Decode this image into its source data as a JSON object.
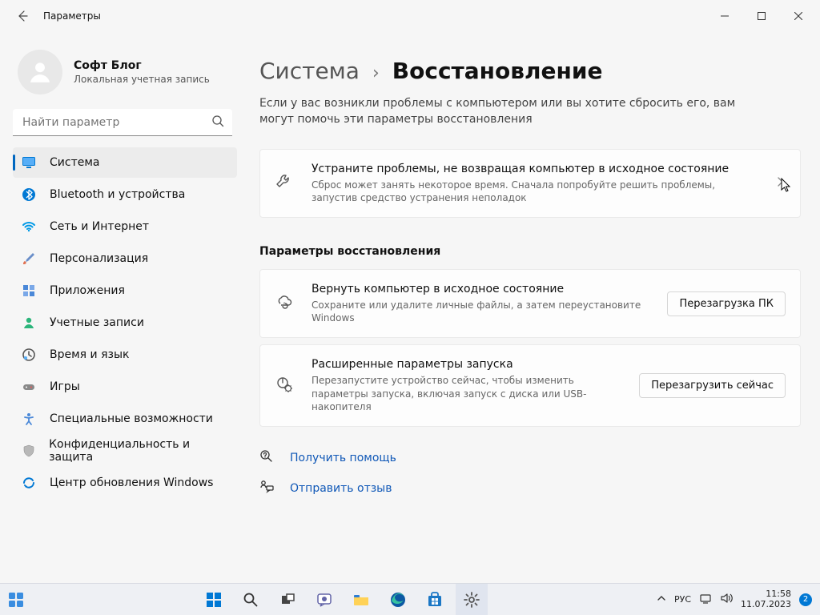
{
  "window": {
    "title": "Параметры"
  },
  "profile": {
    "name": "Софт Блог",
    "sub": "Локальная учетная запись"
  },
  "search": {
    "placeholder": "Найти параметр"
  },
  "nav": {
    "items": [
      {
        "label": "Система"
      },
      {
        "label": "Bluetooth и устройства"
      },
      {
        "label": "Сеть и Интернет"
      },
      {
        "label": "Персонализация"
      },
      {
        "label": "Приложения"
      },
      {
        "label": "Учетные записи"
      },
      {
        "label": "Время и язык"
      },
      {
        "label": "Игры"
      },
      {
        "label": "Специальные возможности"
      },
      {
        "label": "Конфиденциальность и защита"
      },
      {
        "label": "Центр обновления Windows"
      }
    ]
  },
  "breadcrumb": {
    "root": "Система",
    "current": "Восстановление"
  },
  "desc": "Если у вас возникли проблемы с компьютером или вы хотите сбросить его, вам могут помочь эти параметры восстановления",
  "card1": {
    "title": "Устраните проблемы, не возвращая компьютер в исходное состояние",
    "sub": "Сброс может занять некоторое время. Сначала попробуйте решить проблемы, запустив средство устранения неполадок"
  },
  "section": "Параметры восстановления",
  "card2": {
    "title": "Вернуть компьютер в исходное состояние",
    "sub": "Сохраните или удалите личные файлы, а затем переустановите Windows",
    "btn": "Перезагрузка ПК"
  },
  "card3": {
    "title": "Расширенные параметры запуска",
    "sub": "Перезапустите устройство сейчас, чтобы изменить параметры запуска, включая запуск с диска или USB-накопителя",
    "btn": "Перезагрузить сейчас"
  },
  "links": {
    "help": "Получить помощь",
    "feedback": "Отправить отзыв"
  },
  "taskbar": {
    "lang": "РУС",
    "time": "11:58",
    "date": "11.07.2023",
    "badge": "2"
  }
}
